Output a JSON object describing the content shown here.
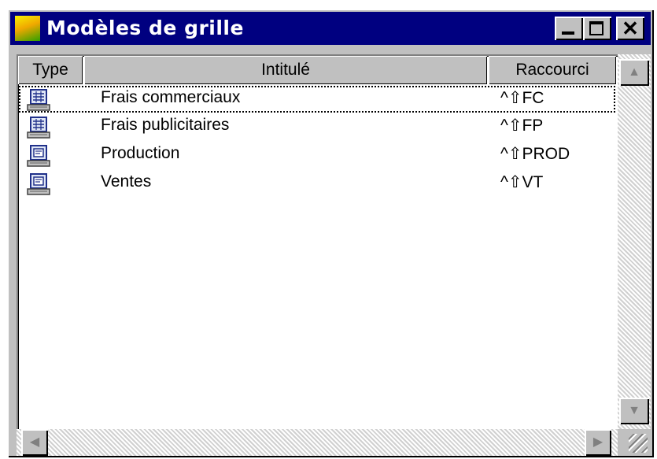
{
  "window": {
    "title": "Modèles de grille",
    "buttons": {
      "minimize": "_",
      "maximize": "□",
      "close": "✕"
    }
  },
  "columns": {
    "type": "Type",
    "label": "Intitulé",
    "shortcut": "Raccourci"
  },
  "rows": [
    {
      "icon": "spreadsheet-icon",
      "label": "Frais commerciaux",
      "shortcut_mod": "^⇧",
      "shortcut": "FC",
      "focused": true
    },
    {
      "icon": "spreadsheet-icon",
      "label": "Frais publicitaires",
      "shortcut_mod": "^⇧",
      "shortcut": "FP"
    },
    {
      "icon": "form-icon",
      "label": "Production",
      "shortcut_mod": "^⇧",
      "shortcut": "PROD"
    },
    {
      "icon": "form-icon",
      "label": "Ventes",
      "shortcut_mod": "^⇧",
      "shortcut": "VT"
    }
  ],
  "colors": {
    "titlebar": "#000080",
    "face": "#c0c0c0",
    "list_bg": "#ffffff"
  }
}
